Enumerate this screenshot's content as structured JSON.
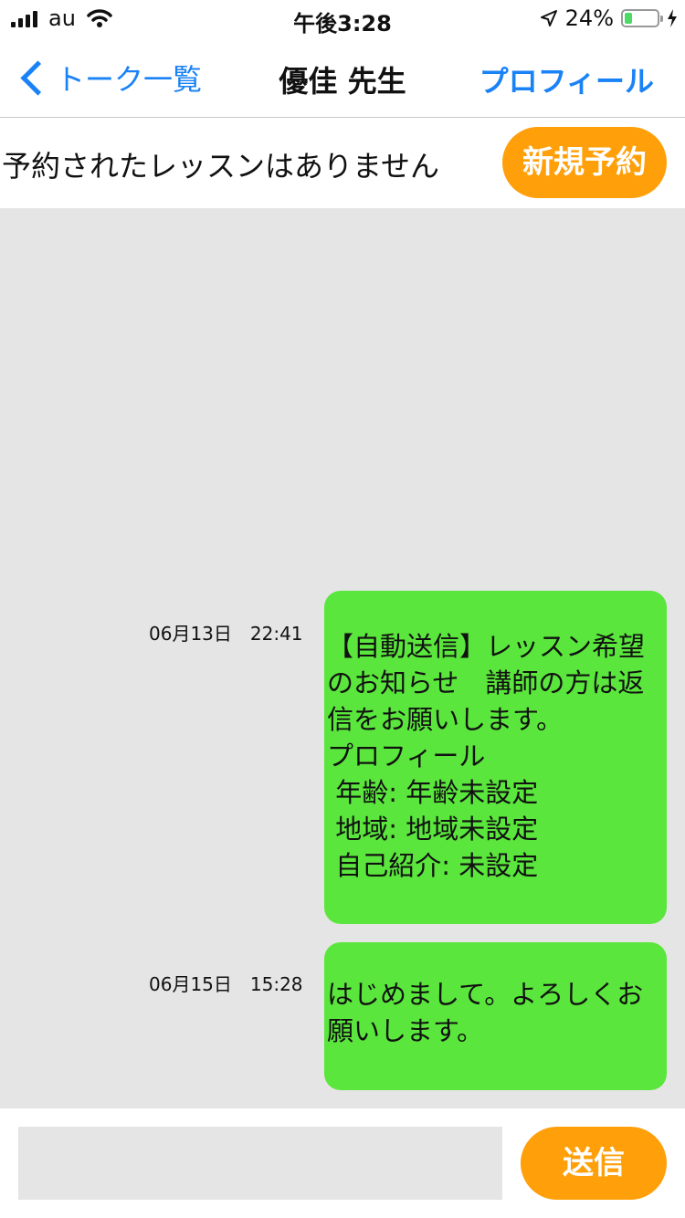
{
  "status_bar": {
    "carrier": "au",
    "time": "午後3:28",
    "battery_percent": "24%",
    "battery_level": 0.24,
    "signal_bars": 4
  },
  "nav": {
    "back_label": "トーク一覧",
    "title": "優佳 先生",
    "profile_label": "プロフィール"
  },
  "reservation": {
    "status_text": "予約されたレッスンはありません",
    "new_button": "新規予約"
  },
  "messages": [
    {
      "time": "06月13日　22:41",
      "text": "【自動送信】レッスン希望のお知らせ　講師の方は返信をお願いします。\nプロフィール\n 年齢: 年齢未設定\n 地域: 地域未設定\n 自己紹介: 未設定"
    },
    {
      "time": "06月15日　15:28",
      "text": "はじめまして。よろしくお願いします。"
    }
  ],
  "composer": {
    "placeholder": "",
    "send_label": "送信"
  },
  "colors": {
    "accent_blue": "#1a82f7",
    "button_orange": "#ff9f0a",
    "bubble_green": "#5ae63c",
    "chat_background": "#e5e5e5"
  }
}
